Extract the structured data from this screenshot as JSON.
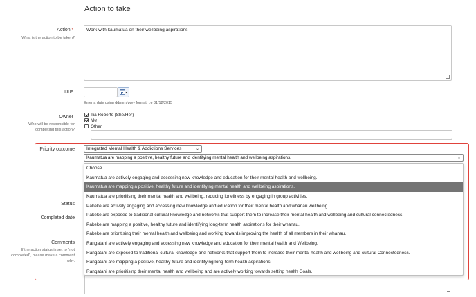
{
  "section": {
    "title": "Action to take"
  },
  "action": {
    "label": "Action",
    "required_mark": "*",
    "hint": "What is the action to be taken?",
    "value": "Work with kaumatua on their wellbeing aspirations"
  },
  "due": {
    "label": "Due",
    "value": "",
    "format_hint": "Enter a date using dd/mm/yyyy format, i.e 31/12/2015",
    "calendar_icon": "calendar-icon"
  },
  "owner": {
    "label": "Owner",
    "hint_lines": [
      "Who will be responsible for",
      "completing this action?"
    ],
    "options": [
      {
        "label": "Tia Roberts (She/Her)",
        "checked": true
      },
      {
        "label": "Me",
        "checked": true
      },
      {
        "label": "Other",
        "checked": false
      }
    ],
    "other_value": ""
  },
  "priority": {
    "label": "Priority outcome",
    "category_selected": "Integrated Mental Health & Addictions Services",
    "outcome_selected": "Kaumatua are mapping a positive, healthy future and identifying mental health and wellbeing aspirations.",
    "options": [
      "Choose...",
      "Kaumatua are actively engaging and accessing new knowledge and education for their mental health and wellbeing.",
      "Kaumatua are mapping a positive, healthy future and identifying mental health and wellbeing aspirations.",
      "Kaumatua are prioritising their mental health and wellbeing, reducing loneliness by engaging in group activities.",
      "Pakeke are actively engaging and accessing new knowledge and education for their mental health and whanau wellbeing.",
      "Pakeke are exposed to traditional cultural knowledge and networks that support them to increase their mental health and wellbeing and cultural connectedness.",
      "Pakeke are mapping a positive, healthy future and identifying long-term health aspirations for their whanau.",
      "Pakeke are prioritising their mental health and wellbeing and working towards improving the health of all members in their whanau.",
      "Rangatahi are actively engaging and accessing new knowledge and education for their mental health and Wellbeing.",
      "Rangatahi are exposed to traditional cultural knowledge and networks that support them to increase their mental health and wellbeing and cultural Connectedness.",
      "Rangatahi are mapping a positive, healthy future and identifying long-term health aspirations.",
      "Rangatahi are prioritising their mental health and wellbeing and are actively working towards setting health Goals."
    ],
    "selected_index": 2,
    "highlight_color": "#e0433c"
  },
  "status": {
    "label": "Status"
  },
  "completed_date": {
    "label": "Completed date"
  },
  "comments": {
    "label": "Comments",
    "hint_lines": [
      "If the action status is set to \"not",
      "completed\", please make a comment",
      "why."
    ]
  }
}
